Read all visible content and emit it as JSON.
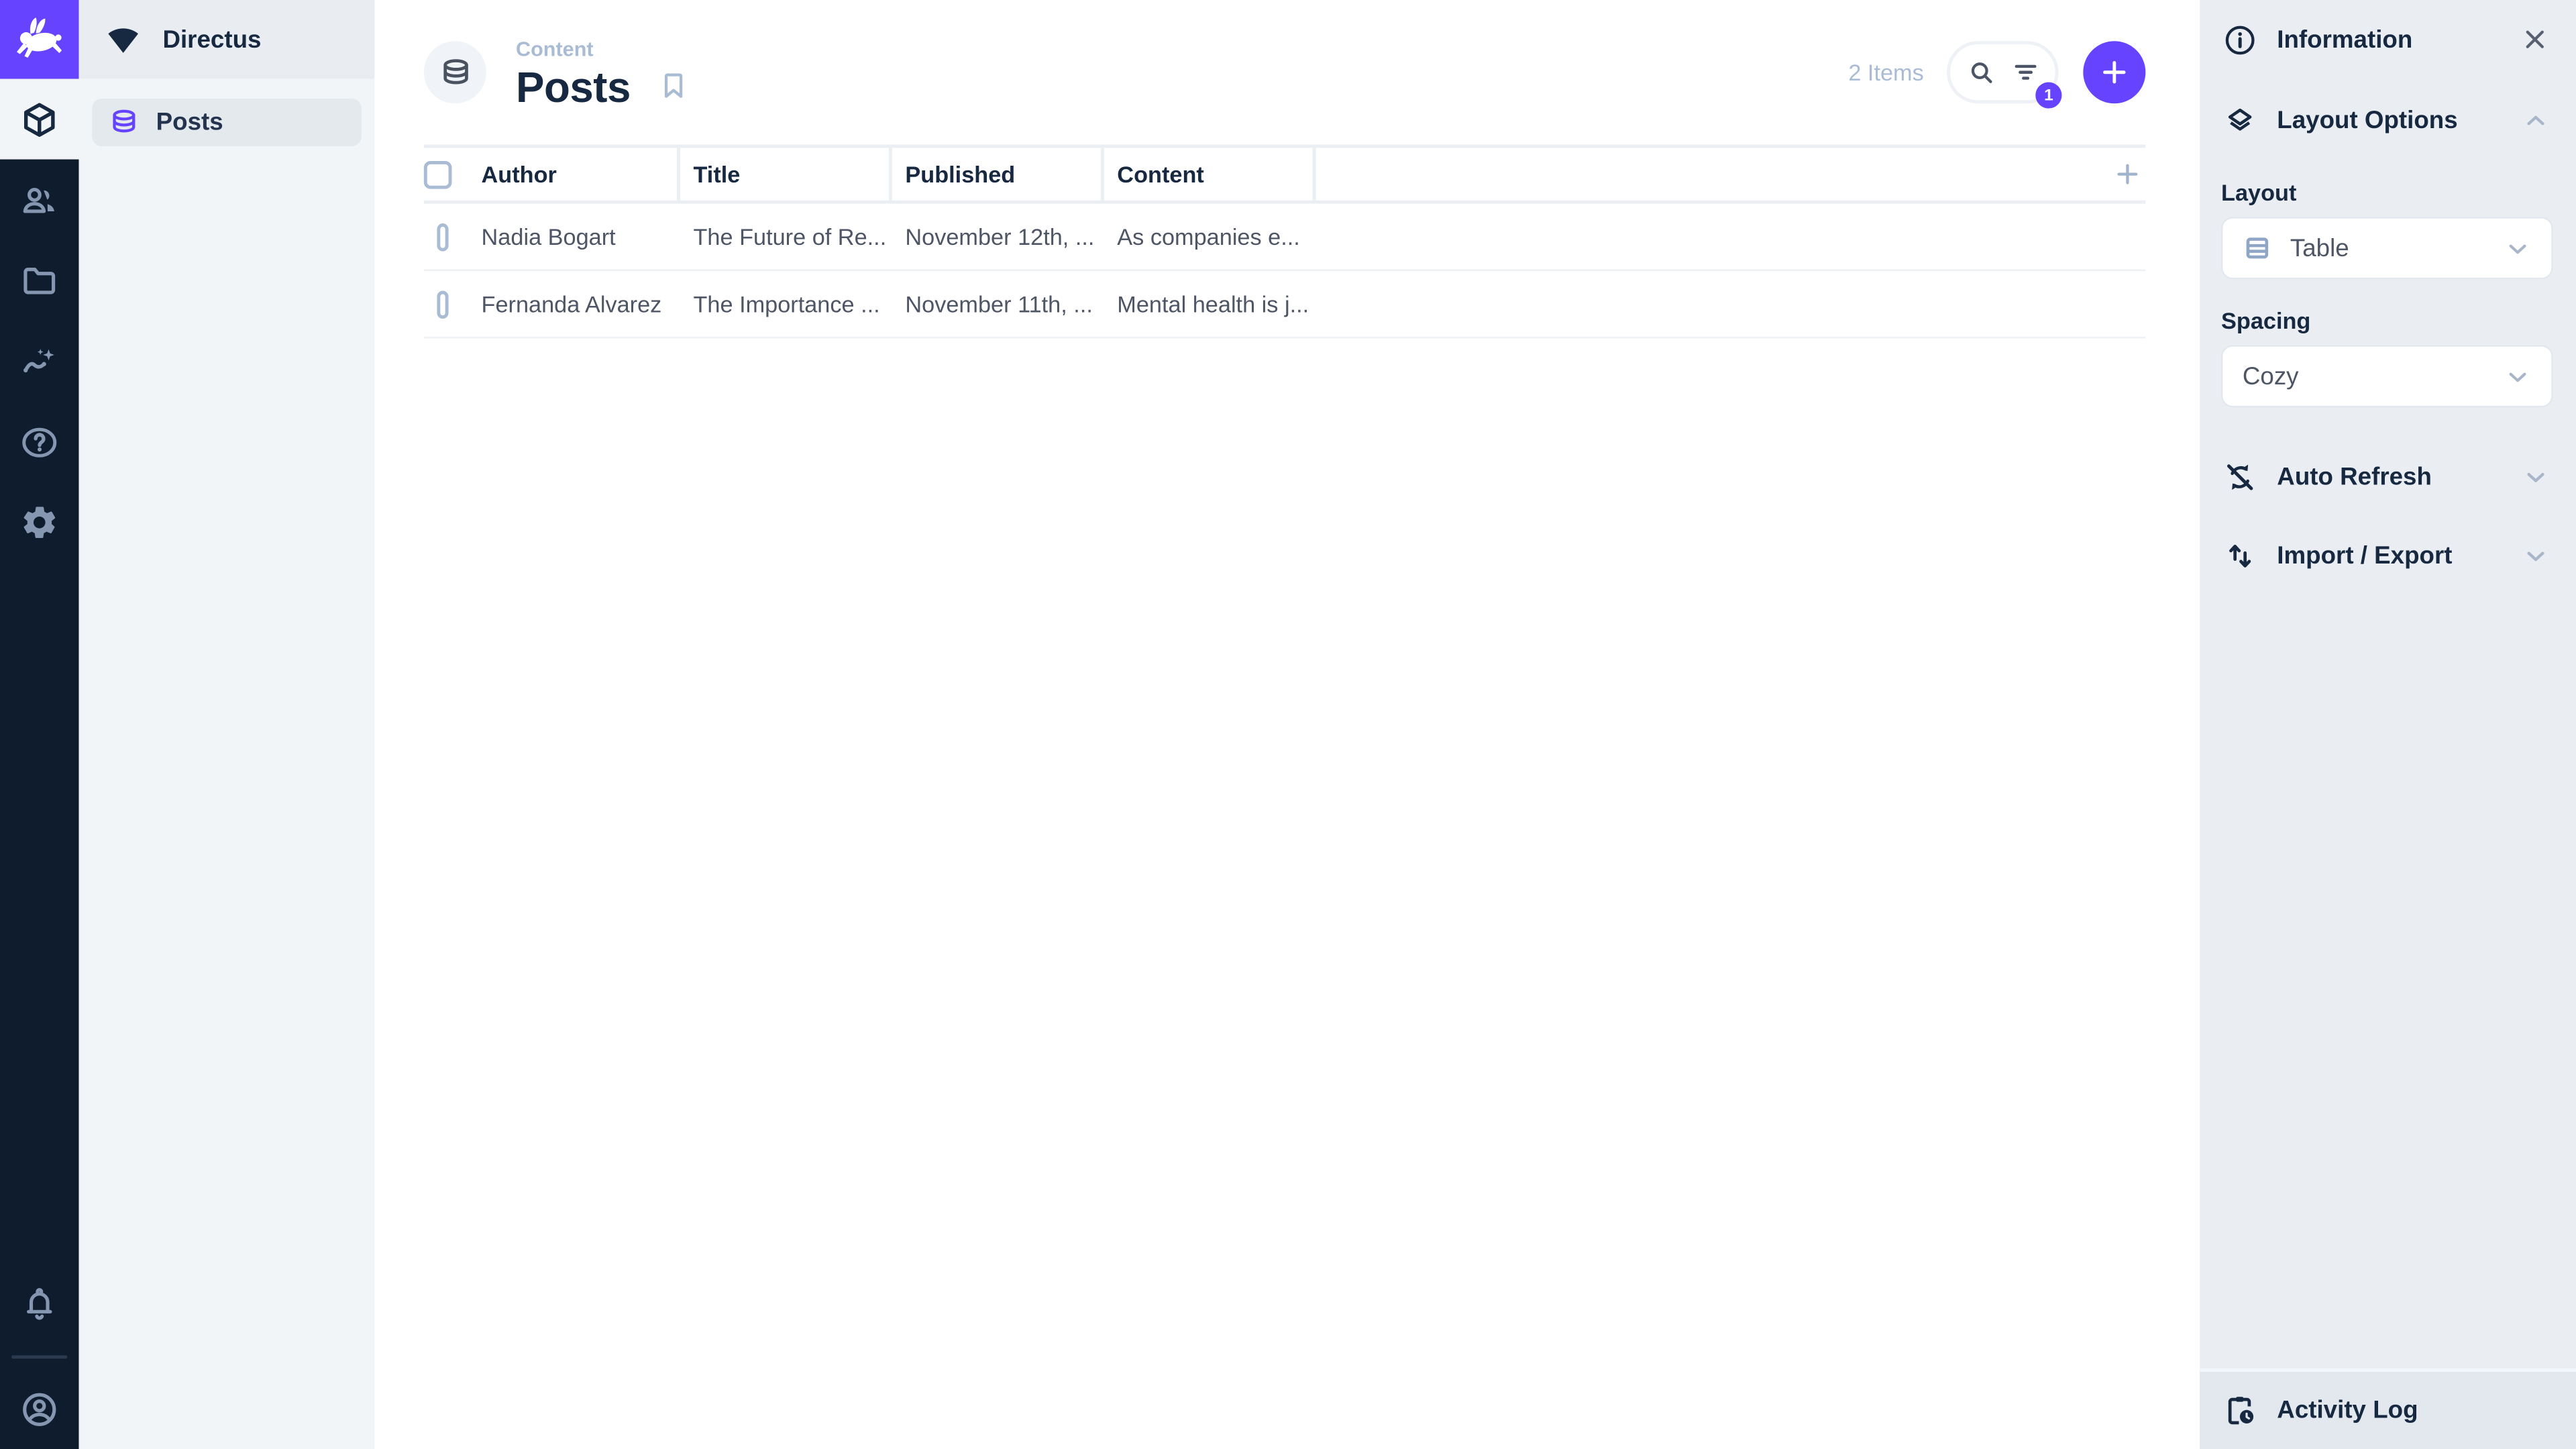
{
  "colors": {
    "accent": "#6644ff",
    "module_bar": "#0f1c2e",
    "navy_text": "#172940",
    "muted_blue": "#a9bcd4",
    "body_text": "#4e5564",
    "sidebar_bg": "#eaeef3"
  },
  "module_bar": {
    "logo_icon": "directus-rabbit-icon",
    "modules": [
      {
        "name": "content",
        "icon": "box-icon",
        "active": true
      },
      {
        "name": "users",
        "icon": "people-icon",
        "active": false
      },
      {
        "name": "files",
        "icon": "folder-icon",
        "active": false
      },
      {
        "name": "insights",
        "icon": "insights-icon",
        "active": false
      },
      {
        "name": "help",
        "icon": "help-icon",
        "active": false
      },
      {
        "name": "settings",
        "icon": "gear-icon",
        "active": false
      }
    ],
    "bottom": [
      {
        "name": "notifications",
        "icon": "bell-icon"
      },
      {
        "name": "account",
        "icon": "account-circle-icon"
      }
    ]
  },
  "nav": {
    "project_name": "Directus",
    "project_icon": "fan-icon",
    "items": [
      {
        "label": "Posts",
        "icon": "database-icon",
        "active": true
      }
    ]
  },
  "header": {
    "breadcrumb": "Content",
    "title": "Posts",
    "title_icon": "database-icon",
    "bookmark_icon": "bookmark-icon",
    "items_count": "2 Items",
    "search_icon": "search-icon",
    "filter_icon": "filter-icon",
    "filter_badge": "1",
    "add_icon": "plus-icon"
  },
  "table": {
    "columns": [
      "Author",
      "Title",
      "Published",
      "Content"
    ],
    "add_column_icon": "plus-icon",
    "rows": [
      {
        "author": "Nadia Bogart",
        "title": "The Future of Re...",
        "published": "November 12th, ...",
        "content": "As companies e..."
      },
      {
        "author": "Fernanda Alvarez",
        "title": "The Importance ...",
        "published": "November 11th, ...",
        "content": "Mental health is j..."
      }
    ]
  },
  "sidebar": {
    "information": {
      "label": "Information",
      "icon": "info-icon",
      "close_icon": "close-icon"
    },
    "layout_options": {
      "label": "Layout Options",
      "icon": "layers-icon",
      "chevron": "chevron-up-icon"
    },
    "layout_field": {
      "label": "Layout",
      "value": "Table",
      "icon": "table-icon"
    },
    "spacing_field": {
      "label": "Spacing",
      "value": "Cozy"
    },
    "auto_refresh": {
      "label": "Auto Refresh",
      "icon": "sync-disabled-icon",
      "chevron": "chevron-down-icon"
    },
    "import_export": {
      "label": "Import / Export",
      "icon": "swap-vert-icon",
      "chevron": "chevron-down-icon"
    },
    "footer": {
      "label": "Activity Log",
      "icon": "clipboard-clock-icon"
    }
  }
}
